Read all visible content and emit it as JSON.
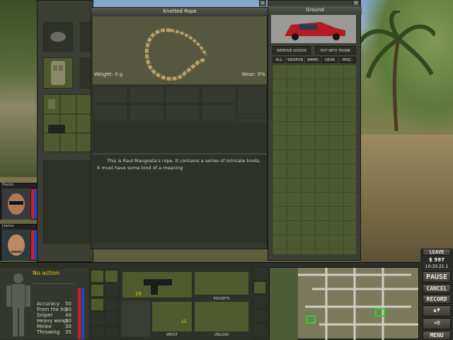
{
  "item_window": {
    "title": "Knotted Rope",
    "weight_label": "Weight: 0 g",
    "wear_label": "Wear: 0%",
    "description": "This is Raul Mangosta's rope. It contains a series of intricate knots. It must have some kind of a meaning"
  },
  "ground_window": {
    "title": "Ground",
    "remove_goods_label": "REMOVE GOODS",
    "put_into_trunk_label": "PUT INTO TRUNK",
    "tabs": [
      "ALL",
      "WEAPON",
      "AMMO",
      "GEAR",
      "MISC."
    ]
  },
  "mercs": [
    {
      "name": "Pasolo"
    },
    {
      "name": "Ivanov"
    }
  ],
  "selected_merc": {
    "action_label": "No action",
    "stats": [
      {
        "label": "Accuracy",
        "value": "50"
      },
      {
        "label": "From the hip",
        "value": "30"
      },
      {
        "label": "Sniper",
        "value": "40"
      },
      {
        "label": "Heavy weap.",
        "value": "30"
      },
      {
        "label": "Melee",
        "value": "30"
      },
      {
        "label": "Throwing",
        "value": "35"
      }
    ]
  },
  "weapon_panel": {
    "ammo_count": "15",
    "pockets_label": "POCKETS",
    "wrist_label": "WRIST",
    "unload_label": "UNLOAD",
    "secondary_count": "15"
  },
  "right_controls": {
    "leave_label": "LEAVE",
    "money": "$ 597",
    "time": "10:33:21.1",
    "pause_label": "PAUSE",
    "cancel_label": "CANCEL",
    "record_label": "RECORD",
    "menu_label": "MENU"
  },
  "colors": {
    "accent_yellow": "#f0d800",
    "health_red": "#d02020",
    "energy_blue": "#3040c0"
  }
}
